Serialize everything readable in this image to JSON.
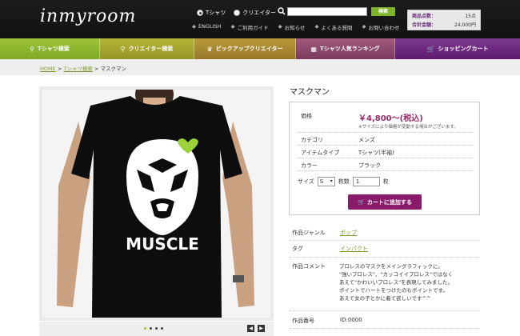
{
  "header": {
    "logo": "inmyroom",
    "search_options": [
      "Tシャツ",
      "クリエイター"
    ],
    "search_button": "検索",
    "util_links": [
      "ENGLISH",
      "ご利用ガイド",
      "お知らせ",
      "よくある質問",
      "お問い合わせ"
    ],
    "cart_summary": {
      "count_label": "商品点数：",
      "count_value": "15点",
      "total_label": "合計金額：",
      "total_value": "24,000円"
    }
  },
  "nav": {
    "items": [
      {
        "label": "Tシャツ検索",
        "icon": "search-icon",
        "color": "#8ab52c"
      },
      {
        "label": "クリエイター検索",
        "icon": "search-icon",
        "color": "#a4a52a"
      },
      {
        "label": "ピックアップクリエイター",
        "icon": "crown-icon",
        "color": "#a58a2a"
      },
      {
        "label": "Tシャツ人気ランキング",
        "icon": "ranking-icon",
        "color": "#8a4a6e"
      },
      {
        "label": "ショッピングカート",
        "icon": "cart-icon",
        "color": "#6a2a7a"
      }
    ]
  },
  "breadcrumb": {
    "home": "HOME",
    "sep1": ">",
    "search": "Tシャツ検索",
    "sep2": ">",
    "current": "マスクマン"
  },
  "product": {
    "title": "マスクマン",
    "shirt_text": "MUSCLE",
    "specs": {
      "price_label": "価格",
      "price_value": "￥4,800～(税込)",
      "price_note": "※サイズにより価格が変動する場合がございます。",
      "category_label": "カテゴリ",
      "category_value": "メンズ",
      "type_label": "アイテムタイプ",
      "type_value": "Tシャツ(半袖)",
      "color_label": "カラー",
      "color_value": "ブラック"
    },
    "size_label": "サイズ",
    "size_value": "S",
    "qty_label": "枚数",
    "qty_value": "1",
    "qty_unit": "枚",
    "cart_button": "カートに追加する",
    "info": {
      "genre_label": "作品ジャンル",
      "genre_value": "ポップ",
      "tag_label": "タグ",
      "tag_value": "インパクト",
      "comment_label": "作品コメント",
      "comment_value": "プロレスのマスクをメイングラフィックに。\n\"強いプロレス\"、\"カッコイイプロレス\"ではなく\nあえて\"かわいいプロレス\"を表現してみました。\nポイントでハートをつけたのもポイントです。\nあえて女の子とかに着て欲しいです^^",
      "id_label": "作品番号",
      "id_value": "ID:0000"
    }
  },
  "colors": {
    "header_bg": "#151515",
    "accent_green": "#7fb32a",
    "accent_purple": "#8a1a6a"
  }
}
